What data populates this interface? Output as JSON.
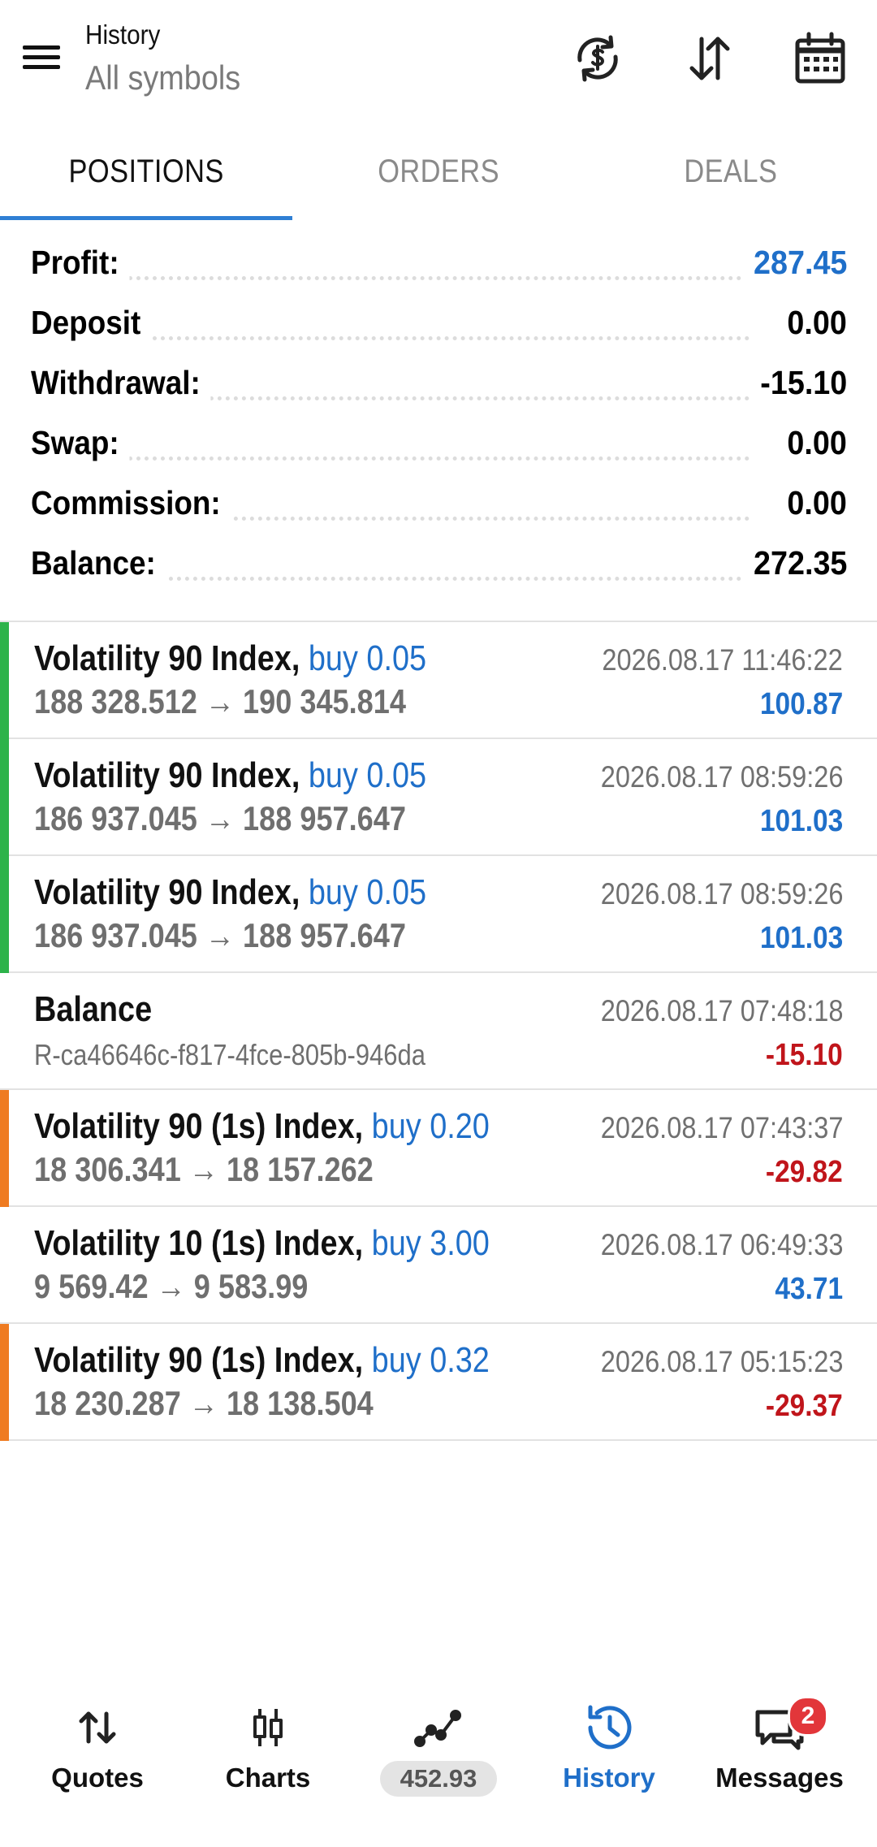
{
  "header": {
    "title": "History",
    "subtitle": "All symbols",
    "icons": [
      "currency-sync-icon",
      "sort-arrows-icon",
      "calendar-icon"
    ]
  },
  "tabs": [
    {
      "label": "POSITIONS",
      "active": true
    },
    {
      "label": "ORDERS",
      "active": false
    },
    {
      "label": "DEALS",
      "active": false
    }
  ],
  "summary": [
    {
      "label": "Profit:",
      "value": "287.45",
      "highlight": true
    },
    {
      "label": "Deposit",
      "value": "0.00"
    },
    {
      "label": "Withdrawal:",
      "value": "-15.10"
    },
    {
      "label": "Swap:",
      "value": "0.00"
    },
    {
      "label": "Commission:",
      "value": "0.00"
    },
    {
      "label": "Balance:",
      "value": "272.35"
    }
  ],
  "deals": [
    {
      "symbol": "Volatility 90 Index,",
      "action": "buy 0.05",
      "prices": "188 328.512 → 190 345.814",
      "time": "2026.08.17 11:46:22",
      "profit": "100.87",
      "sign": "positive",
      "marker": "green"
    },
    {
      "symbol": "Volatility 90 Index,",
      "action": "buy 0.05",
      "prices": "186 937.045 → 188 957.647",
      "time": "2026.08.17 08:59:26",
      "profit": "101.03",
      "sign": "positive",
      "marker": "green"
    },
    {
      "symbol": "Volatility 90 Index,",
      "action": "buy 0.05",
      "prices": "186 937.045 → 188 957.647",
      "time": "2026.08.17 08:59:26",
      "profit": "101.03",
      "sign": "positive",
      "marker": "green"
    },
    {
      "symbol": "Balance",
      "action": "",
      "prices": "R-ca46646c-f817-4fce-805b-946da",
      "time": "2026.08.17 07:48:18",
      "profit": "-15.10",
      "sign": "negative",
      "marker": "none"
    },
    {
      "symbol": "Volatility 90 (1s) Index,",
      "action": "buy 0.20",
      "prices": "18 306.341 → 18 157.262",
      "time": "2026.08.17 07:43:37",
      "profit": "-29.82",
      "sign": "negative",
      "marker": "orange"
    },
    {
      "symbol": "Volatility 10 (1s) Index,",
      "action": "buy 3.00",
      "prices": "9 569.42 → 9 583.99",
      "time": "2026.08.17 06:49:33",
      "profit": "43.71",
      "sign": "positive",
      "marker": "none"
    },
    {
      "symbol": "Volatility 90 (1s) Index,",
      "action": "buy 0.32",
      "prices": "18 230.287 → 18 138.504",
      "time": "2026.08.17 05:15:23",
      "profit": "-29.37",
      "sign": "negative",
      "marker": "orange"
    }
  ],
  "bottom_nav": [
    {
      "label": "Quotes",
      "icon": "quotes-arrows-icon",
      "active": false
    },
    {
      "label": "Charts",
      "icon": "candlestick-icon",
      "active": false
    },
    {
      "label": "452.93",
      "icon": "trade-line-icon",
      "active": false
    },
    {
      "label": "History",
      "icon": "history-clock-icon",
      "active": true
    },
    {
      "label": "Messages",
      "icon": "messages-icon",
      "active": false,
      "badge": "2"
    }
  ],
  "colors": {
    "accent": "#1f6fc9",
    "negative": "#c0151b",
    "marker_green": "#2db34a",
    "marker_orange": "#ef7b21",
    "badge": "#e2363a"
  }
}
